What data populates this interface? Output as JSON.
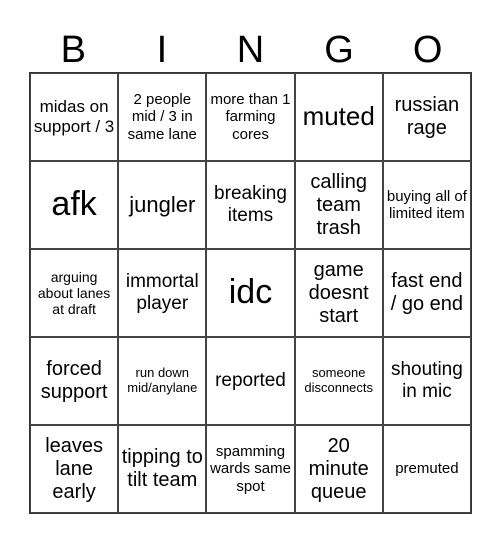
{
  "header": [
    "B",
    "I",
    "N",
    "G",
    "O"
  ],
  "cells": [
    "midas on support / 3",
    "2 people mid / 3 in same lane",
    "more than 1 farming cores",
    "muted",
    "russian rage",
    "afk",
    "jungler",
    "breaking items",
    "calling team trash",
    "buying all of limited item",
    "arguing about lanes at draft",
    "immortal player",
    "idc",
    "game doesnt start",
    "fast end / go end",
    "forced support",
    "run down mid/anylane",
    "reported",
    "someone disconnects",
    "shouting in mic",
    "leaves lane early",
    "tipping to tilt team",
    "spamming wards same spot",
    "20 minute queue",
    "premuted"
  ]
}
